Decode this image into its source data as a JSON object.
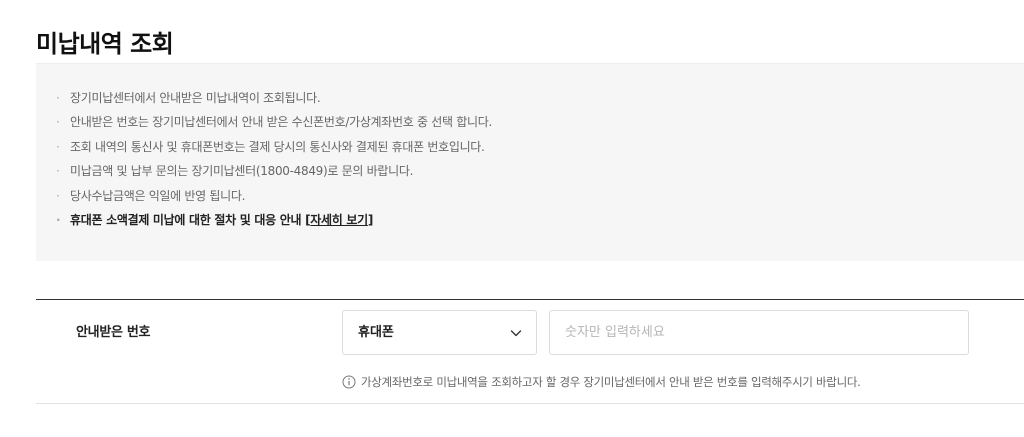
{
  "page": {
    "title": "미납내역 조회"
  },
  "notice": {
    "items": [
      {
        "text": "장기미납센터에서 안내받은 미납내역이 조회됩니다."
      },
      {
        "text": "안내받은 번호는 장기미납센터에서 안내 받은 수신폰번호/가상계좌번호 중 선택 합니다."
      },
      {
        "text": "조회 내역의 통신사 및 휴대폰번호는 결제 당시의 통신사와 결제된 휴대폰 번호입니다."
      },
      {
        "text": "미납금액 및 납부 문의는 장기미납센터(1800-4849)로 문의 바랍니다."
      },
      {
        "text": "당사수납금액은 익일에 반영 됩니다."
      }
    ],
    "strong_item": {
      "text": "휴대폰 소액결제 미납에 대한 절차 및 대응 안내 [",
      "link_label": "자세히 보기",
      "suffix": "]"
    }
  },
  "form": {
    "label": "안내받은 번호",
    "select": {
      "selected": "휴대폰",
      "icon": "chevron-down-icon"
    },
    "input": {
      "value": "",
      "placeholder": "숫자만 입력하세요"
    },
    "help": {
      "icon": "info-circle-icon",
      "text": "가상계좌번호로 미납내역을 조회하고자 할 경우 장기미납센터에서 안내 받은 번호를 입력해주시기 바랍니다."
    }
  },
  "colors": {
    "notice_background": "#f6f6f6",
    "form_top_line": "#333333",
    "border": "#dcdcdc"
  }
}
